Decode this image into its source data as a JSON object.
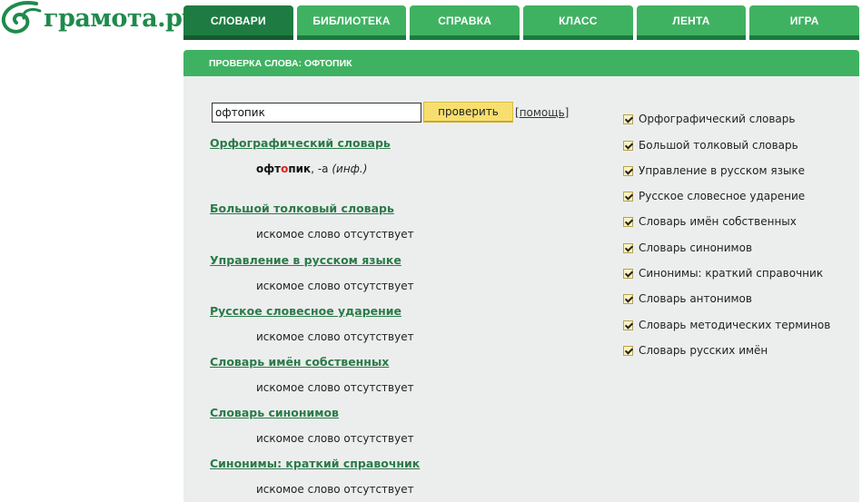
{
  "logo": {
    "text": "грамота.ру",
    "icon": "spiral-logo-icon"
  },
  "nav": {
    "tabs": [
      "СЛОВАРИ",
      "БИБЛИОТЕКА",
      "СПРАВКА",
      "КЛАСС",
      "ЛЕНТА",
      "ИГРА"
    ],
    "active": "СЛОВАРИ"
  },
  "section": {
    "title": "ПРОВЕРКА СЛОВА: ОФТОПИК"
  },
  "search": {
    "value": "офтопик",
    "button": "проверить",
    "help_bracket_open": "[",
    "help": "помощь",
    "help_bracket_close": "]"
  },
  "entry": {
    "word_a": "офт",
    "word_stress": "о",
    "word_b": "пик",
    "grammar": ", -а ",
    "note": "(инф.)"
  },
  "results": [
    {
      "dict": "Орфографический словарь",
      "text": ""
    },
    {
      "dict": "Большой толковый словарь",
      "text": "искомое слово отсутствует"
    },
    {
      "dict": "Управление в русском языке",
      "text": "искомое слово отсутствует"
    },
    {
      "dict": "Русское словесное ударение",
      "text": "искомое слово отсутствует"
    },
    {
      "dict": "Словарь имён собственных",
      "text": "искомое слово отсутствует"
    },
    {
      "dict": "Словарь синонимов",
      "text": "искомое слово отсутствует"
    },
    {
      "dict": "Синонимы: краткий справочник",
      "text": "искомое слово отсутствует"
    }
  ],
  "dictionaries": [
    "Орфографический словарь",
    "Большой толковый словарь",
    "Управление в русском языке",
    "Русское словесное ударение",
    "Словарь имён собственных",
    "Словарь синонимов",
    "Синонимы: краткий справочник",
    "Словарь антонимов",
    "Словарь методических терминов",
    "Словарь русских имён"
  ],
  "colors": {
    "brand_green": "#3fb262",
    "active_tab": "#1e7c42",
    "link_green": "#2b7a48",
    "button_yellow": "#f7df6f",
    "stress_red": "#e0201a",
    "panel_bg": "#eceeee"
  }
}
